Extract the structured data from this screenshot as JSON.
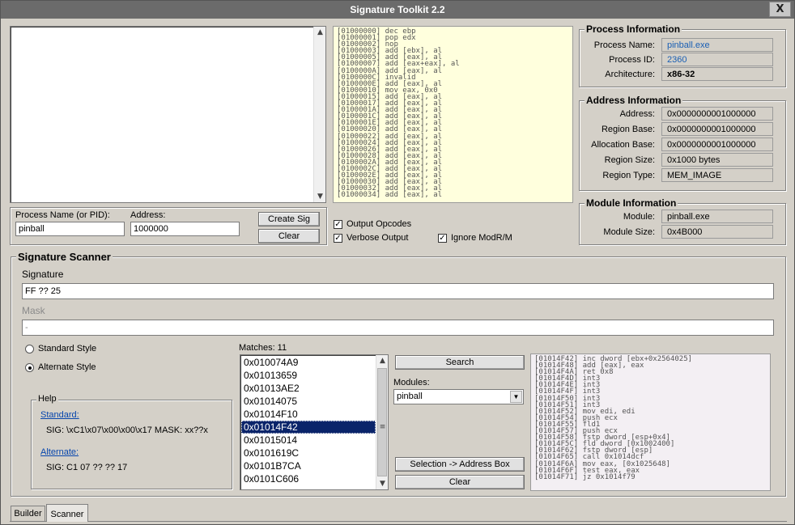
{
  "window": {
    "title": "Signature Toolkit 2.2",
    "close_label": "X"
  },
  "disasm_top": [
    "[01000000] dec ebp",
    "[01000001] pop edx",
    "[01000002] nop",
    "[01000003] add [ebx], al",
    "[01000005] add [eax], al",
    "[01000007] add [eax+eax], al",
    "[0100000A] add [eax], al",
    "[0100000C] invalid",
    "[0100000E] add [eax], al",
    "[01000010] mov eax, 0x0",
    "[01000015] add [eax], al",
    "[01000017] add [eax], al",
    "[0100001A] add [eax], al",
    "[0100001C] add [eax], al",
    "[0100001E] add [eax], al",
    "[01000020] add [eax], al",
    "[01000022] add [eax], al",
    "[01000024] add [eax], al",
    "[01000026] add [eax], al",
    "[01000028] add [eax], al",
    "[0100002A] add [eax], al",
    "[0100002C] add [eax], al",
    "[0100002E] add [eax], al",
    "[01000030] add [eax], al",
    "[01000032] add [eax], al",
    "[01000034] add [eax], al"
  ],
  "input_area": {
    "process_label": "Process Name (or PID):",
    "process_value": "pinball",
    "address_label": "Address:",
    "address_value": "1000000",
    "create_sig": "Create Sig",
    "clear": "Clear"
  },
  "options": {
    "output_opcodes": "Output Opcodes",
    "verbose_output": "Verbose Output",
    "ignore_modrm": "Ignore ModR/M",
    "check_mark": "✓"
  },
  "process_info": {
    "title": "Process Information",
    "name_label": "Process Name:",
    "name_value": "pinball.exe",
    "id_label": "Process ID:",
    "id_value": "2360",
    "arch_label": "Architecture:",
    "arch_value": "x86-32"
  },
  "address_info": {
    "title": "Address Information",
    "rows": [
      {
        "label": "Address:",
        "value": "0x0000000001000000"
      },
      {
        "label": "Region Base:",
        "value": "0x0000000001000000"
      },
      {
        "label": "Allocation Base:",
        "value": "0x0000000001000000"
      },
      {
        "label": "Region Size:",
        "value": "0x1000 bytes"
      },
      {
        "label": "Region Type:",
        "value": "MEM_IMAGE"
      }
    ]
  },
  "module_info": {
    "title": "Module Information",
    "module_label": "Module:",
    "module_value": "pinball.exe",
    "size_label": "Module Size:",
    "size_value": "0x4B000"
  },
  "scanner": {
    "title": "Signature Scanner",
    "signature_label": "Signature",
    "signature_value": "FF ?? 25",
    "mask_label": "Mask",
    "mask_value": "-",
    "standard_style": "Standard Style",
    "alternate_style": "Alternate Style",
    "matches_label": "Matches: 11",
    "matches": [
      "0x010074A9",
      "0x01013659",
      "0x01013AE2",
      "0x01014075",
      "0x01014F10",
      "0x01014F42",
      "0x01015014",
      "0x0101619C",
      "0x0101B7CA",
      "0x0101C606"
    ],
    "selected_match": "0x01014F42",
    "search": "Search",
    "modules_label": "Modules:",
    "modules_value": "pinball",
    "selection_to_address": "Selection -> Address Box",
    "clear": "Clear",
    "help": {
      "title": "Help",
      "standard_link": "Standard:",
      "standard_text": "SIG: \\xC1\\x07\\x00\\x00\\x17  MASK: xx??x",
      "alternate_link": "Alternate:",
      "alternate_text": "SIG: C1 07 ?? ?? 17"
    },
    "disasm": [
      "[01014F42] inc dword [ebx+0x2564025]",
      "[01014F48] add [eax], eax",
      "[01014F4A] ret 0x8",
      "[01014F4D] int3",
      "[01014F4E] int3",
      "[01014F4F] int3",
      "[01014F50] int3",
      "[01014F51] int3",
      "[01014F52] mov edi, edi",
      "[01014F54] push ecx",
      "[01014F55] fld1",
      "[01014F57] push ecx",
      "[01014F58] fstp dword [esp+0x4]",
      "[01014F5C] fld dword [0x1002400]",
      "[01014F62] fstp dword [esp]",
      "[01014F65] call 0x1014dcf",
      "[01014F6A] mov eax, [0x1025648]",
      "[01014F6F] test eax, eax",
      "[01014F71] jz 0x1014f79"
    ]
  },
  "tabs": {
    "builder": "Builder",
    "scanner": "Scanner"
  },
  "colors": {
    "accent_link": "#0645ad",
    "selection": "#0a246a",
    "disasm_bg": "#ffffdd",
    "scanner_disasm_bg": "#f3eff3"
  }
}
